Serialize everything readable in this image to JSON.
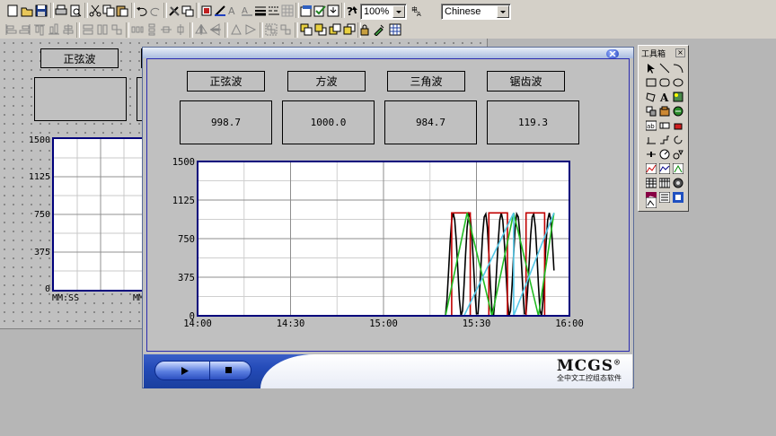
{
  "toolbar": {
    "zoom": "100%",
    "language": "Chinese"
  },
  "editor": {
    "button_label": "正弦波",
    "y_ticks": [
      "1500",
      "1125",
      "750",
      "375",
      "0"
    ],
    "x_labels": [
      "MM:SS",
      "MM"
    ]
  },
  "run_window": {
    "buttons": [
      "正弦波",
      "方波",
      "三角波",
      "锯齿波"
    ],
    "values": [
      "998.7",
      "1000.0",
      "984.7",
      "119.3"
    ],
    "brand": "MCGS",
    "brand_mark": "®",
    "brand_subtitle": "全中文工控组态软件"
  },
  "chart_data": {
    "type": "line",
    "y_ticks": [
      "1500",
      "1125",
      "750",
      "375",
      "0"
    ],
    "x_ticks": [
      "14:00",
      "14:30",
      "15:00",
      "15:30",
      "16:00"
    ],
    "ylim": [
      0,
      1500
    ],
    "xlim": [
      "14:00",
      "16:00"
    ],
    "grid": true,
    "series": [
      {
        "color": "#000000",
        "x": [
          "15:20",
          "15:20.5",
          "15:21",
          "15:21.5",
          "15:22",
          "15:22.5",
          "15:23",
          "15:23.5",
          "15:24",
          "15:24.5",
          "15:25",
          "15:25.5",
          "15:26",
          "15:26.5",
          "15:27",
          "15:27.5",
          "15:28",
          "15:28.5",
          "15:29",
          "15:29.5",
          "15:30",
          "15:30.5",
          "15:31",
          "15:31.5",
          "15:32",
          "15:32.5",
          "15:33",
          "15:33.5",
          "15:34",
          "15:34.5",
          "15:35",
          "15:35.5",
          "15:36",
          "15:36.5",
          "15:37",
          "15:37.5",
          "15:38",
          "15:38.5",
          "15:39",
          "15:39.5",
          "15:40",
          "15:40.5",
          "15:41",
          "15:41.5",
          "15:42",
          "15:42.5",
          "15:43",
          "15:43.5",
          "15:44",
          "15:44.5",
          "15:45",
          "15:45.5",
          "15:46",
          "15:46.5",
          "15:47",
          "15:47.5",
          "15:48",
          "15:48.5",
          "15:49",
          "15:49.5",
          "15:50",
          "15:50.5",
          "15:51",
          "15:51.5",
          "15:52",
          "15:52.5",
          "15:53",
          "15:53.5",
          "15:54",
          "15:54.5",
          "15:55"
        ],
        "values": [
          0,
          160,
          440,
          720,
          930,
          1000,
          930,
          720,
          440,
          160,
          0,
          50,
          300,
          600,
          860,
          990,
          960,
          790,
          520,
          230,
          20,
          20,
          230,
          520,
          790,
          960,
          990,
          860,
          600,
          300,
          50,
          0,
          160,
          440,
          720,
          930,
          1000,
          930,
          720,
          440,
          160,
          0,
          50,
          300,
          600,
          860,
          990,
          960,
          790,
          520,
          230,
          20,
          20,
          230,
          520,
          790,
          960,
          990,
          860,
          600,
          300,
          50,
          0,
          160,
          440,
          720,
          930,
          1000,
          930,
          720,
          440
        ]
      },
      {
        "color": "#c00000",
        "x": [
          "15:22",
          "15:22",
          "15:28",
          "15:28",
          "15:34",
          "15:34",
          "15:40",
          "15:40",
          "15:46",
          "15:46",
          "15:52",
          "15:52",
          "15:55"
        ],
        "values": [
          0,
          1000,
          1000,
          0,
          0,
          1000,
          1000,
          0,
          0,
          1000,
          1000,
          0,
          0
        ]
      },
      {
        "color": "#22bb22",
        "x": [
          "15:20",
          "15:27",
          "15:35",
          "15:42",
          "15:50",
          "15:55"
        ],
        "values": [
          0,
          1000,
          0,
          1000,
          0,
          1000
        ]
      },
      {
        "color": "#55c8e8",
        "x": [
          "15:26",
          "15:42",
          "15:42",
          "15:55"
        ],
        "values": [
          0,
          1000,
          0,
          1000
        ]
      }
    ]
  }
}
